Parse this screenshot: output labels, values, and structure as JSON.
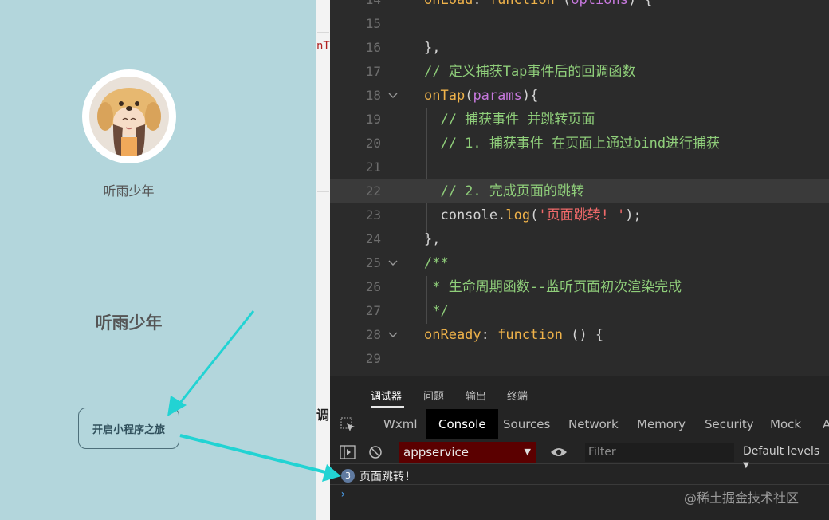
{
  "simulator": {
    "username": "听雨少年",
    "heading": "听雨少年",
    "start_button": "开启小程序之旅"
  },
  "strip": {
    "peek_top": "nT",
    "peek_bottom": "调"
  },
  "editor": {
    "lines": [
      {
        "n": "14",
        "fold": "",
        "html": "<span class=\"fn\">onLoad</span><span class=\"pu\">: </span><span class=\"kw\">function</span><span class=\"pu\"> (</span><span class=\"pm\">options</span><span class=\"pu\">) {</span>"
      },
      {
        "n": "15",
        "fold": "",
        "html": ""
      },
      {
        "n": "16",
        "fold": "",
        "html": "<span class=\"pu\">},</span>"
      },
      {
        "n": "17",
        "fold": "",
        "html": "<span class=\"cm\">// 定义捕获Tap事件后的回调函数</span>"
      },
      {
        "n": "18",
        "fold": "v",
        "html": "<span class=\"fn\">onTap</span><span class=\"pu\">(</span><span class=\"pm\">params</span><span class=\"pu\">){</span>"
      },
      {
        "n": "19",
        "fold": "",
        "html": "<span class=\"cm\">  // 捕获事件 并跳转页面</span>"
      },
      {
        "n": "20",
        "fold": "",
        "html": "<span class=\"cm\">  // 1. 捕获事件 在页面上通过bind进行捕获</span>"
      },
      {
        "n": "21",
        "fold": "",
        "html": ""
      },
      {
        "n": "22",
        "fold": "",
        "html": "<span class=\"cm\">  // 2. 完成页面的跳转</span>"
      },
      {
        "n": "23",
        "fold": "",
        "html": "<span class=\"pu\">  console.</span><span class=\"fn\">log</span><span class=\"pu\">(</span><span class=\"st\">'页面跳转! '</span><span class=\"pu\">);</span>"
      },
      {
        "n": "24",
        "fold": "",
        "html": "<span class=\"pu\">},</span>"
      },
      {
        "n": "25",
        "fold": "v",
        "html": "<span class=\"cm\">/**</span>"
      },
      {
        "n": "26",
        "fold": "",
        "html": "<span class=\"cm\"> * 生命周期函数--监听页面初次渲染完成</span>"
      },
      {
        "n": "27",
        "fold": "",
        "html": "<span class=\"cm\"> */</span>"
      },
      {
        "n": "28",
        "fold": "v",
        "html": "<span class=\"fn\">onReady</span><span class=\"pu\">: </span><span class=\"kw\">function</span><span class=\"pu\"> () {</span>"
      },
      {
        "n": "29",
        "fold": "",
        "html": ""
      }
    ],
    "active_line": "22"
  },
  "devtools": {
    "tabs": [
      "调试器",
      "问题",
      "输出",
      "终端"
    ],
    "active_tab": "调试器",
    "panels": [
      "Wxml",
      "Console",
      "Sources",
      "Network",
      "Memory",
      "Security",
      "Mock",
      "A"
    ],
    "active_panel": "Console",
    "context": "appservice",
    "filter_placeholder": "Filter",
    "levels": "Default levels",
    "log_count": "3",
    "log_message": "页面跳转!",
    "watermark": "@稀土掘金技术社区"
  },
  "colors": {
    "simulator_bg": "#b3d6dc",
    "context_bg": "#5b0000",
    "arrow": "#22d3d3"
  }
}
